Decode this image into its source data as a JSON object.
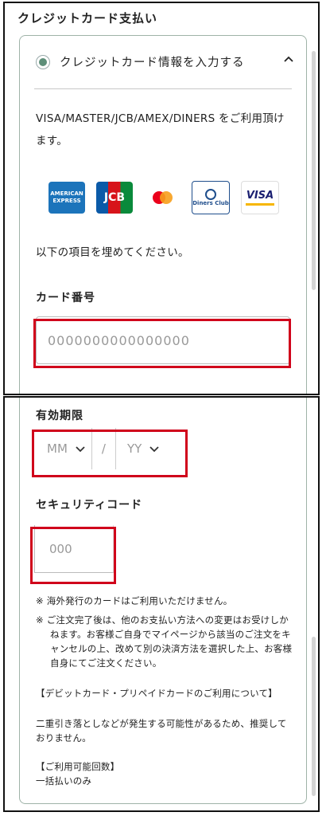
{
  "section_title": "クレジットカード支払い",
  "payment_option": {
    "label": "クレジットカード情報を入力する",
    "chevron_icon": "chevron-up-icon"
  },
  "accepted_cards_text": "VISA/MASTER/JCB/AMEX/DINERS をご利用頂けます。",
  "card_logos": [
    {
      "name": "amex-logo",
      "text": "AMERICAN EXPRESS",
      "color": "#1c74bb"
    },
    {
      "name": "jcb-logo",
      "text": "JCB",
      "color": "#0b5aa8"
    },
    {
      "name": "mastercard-logo",
      "text": "",
      "color": "#eb001b"
    },
    {
      "name": "diners-logo",
      "text": "Diners Club",
      "color": "#1f4e8c"
    },
    {
      "name": "visa-logo",
      "text": "VISA",
      "color": "#1a1f71"
    }
  ],
  "fill_instruction": "以下の項目を埋めてください。",
  "card_number": {
    "label": "カード番号",
    "placeholder": "0000000000000000"
  },
  "expiry": {
    "label": "有効期限",
    "month_placeholder": "MM",
    "separator": "/",
    "year_placeholder": "YY"
  },
  "security_code": {
    "label": "セキュリティコード",
    "placeholder": "000"
  },
  "notes": [
    "※ 海外発行のカードはご利用いただけません。",
    "※ ご注文完了後は、他のお支払い方法への変更はお受けしかねます。お客様ご自身でマイページから該当のご注文をキャンセルの上、改めて別の決済方法を選択した上、お客様自身にてご注文ください。"
  ],
  "debit_heading": "【デビットカード・プリペイドカードのご利用について】",
  "debit_text": "二重引き落としなどが発生する可能性があるため、推奨しておりません。",
  "installments_heading": "【ご利用可能回数】",
  "installments_text": "一括払いのみ",
  "colors": {
    "accent_green": "#5e8f79",
    "highlight_red": "#d0021b",
    "border": "#9fb3a8"
  }
}
